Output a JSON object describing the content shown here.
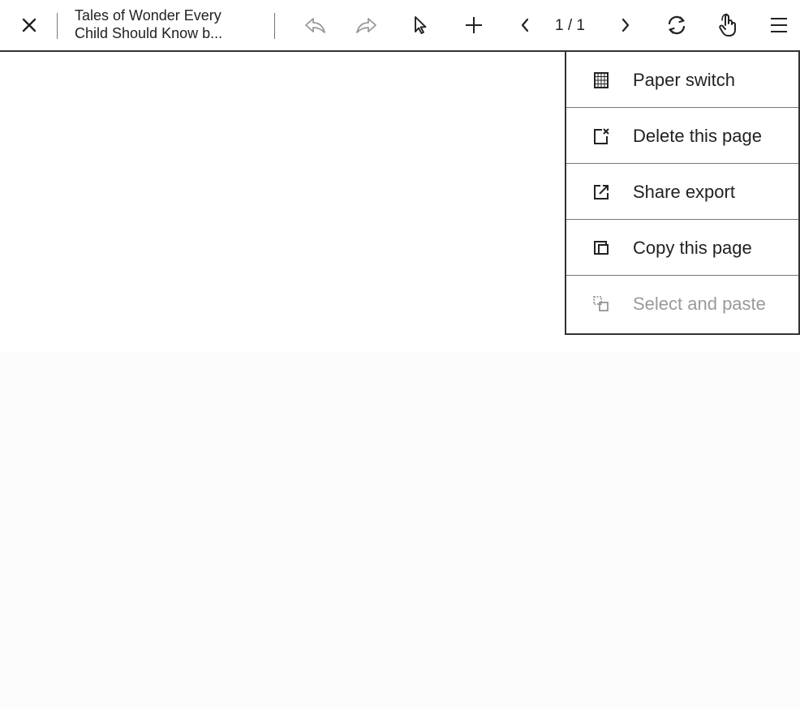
{
  "toolbar": {
    "close_icon": "close-icon",
    "title_line1": "Tales of Wonder Every",
    "title_line2": "Child Should Know b...",
    "icons": {
      "undo": "undo-icon",
      "redo": "redo-icon",
      "select": "pointer-icon",
      "add": "plus-icon",
      "prev": "chevron-left-icon",
      "next": "chevron-right-icon",
      "sync": "sync-icon",
      "touch": "hand-icon",
      "menu": "menu-icon"
    },
    "page_indicator": "1 / 1"
  },
  "menu": {
    "items": [
      {
        "label": "Paper switch",
        "icon": "paper-grid-icon",
        "enabled": true
      },
      {
        "label": "Delete this page",
        "icon": "delete-page-icon",
        "enabled": true
      },
      {
        "label": "Share export",
        "icon": "share-export-icon",
        "enabled": true
      },
      {
        "label": "Copy this page",
        "icon": "copy-page-icon",
        "enabled": true
      },
      {
        "label": "Select and paste",
        "icon": "select-paste-icon",
        "enabled": false
      }
    ]
  },
  "colors": {
    "text": "#222222",
    "disabled_text": "#9a9a9a",
    "border": "#333333",
    "canvas_lower": "#fcfcfc"
  }
}
